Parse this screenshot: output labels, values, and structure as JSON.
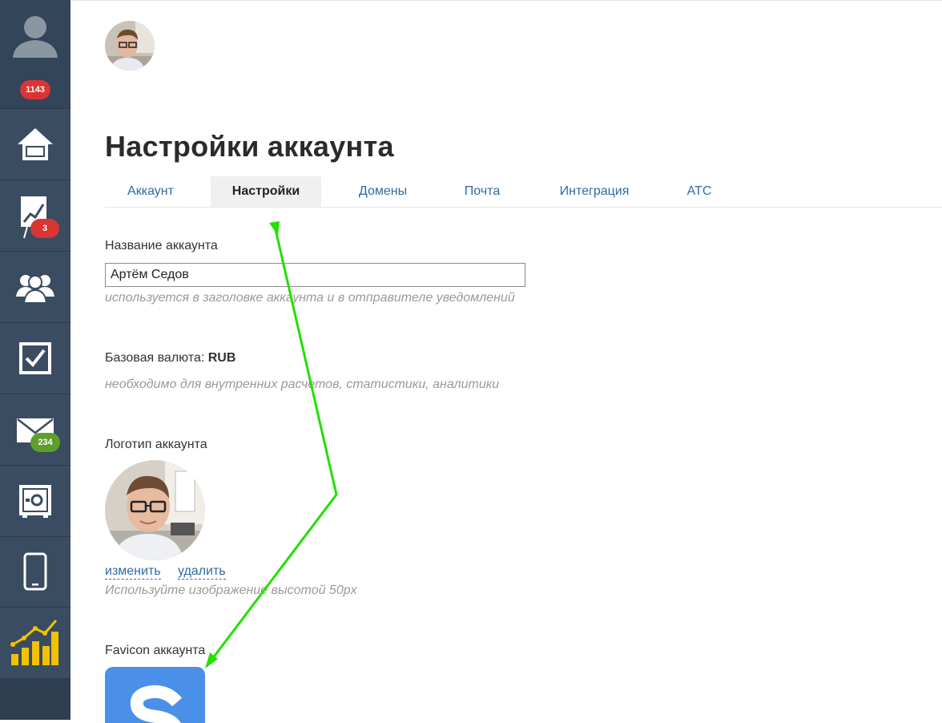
{
  "sidebar": {
    "profile_badge": "1143",
    "deals_badge": "3",
    "mail_badge": "234",
    "badge_red": "#d93535",
    "badge_green": "#5e9f2c",
    "icons": [
      "user-icon",
      "home-icon",
      "chart-board-icon",
      "contacts-icon",
      "tasks-icon",
      "mail-icon",
      "safe-icon",
      "mobile-icon",
      "analytics-icon"
    ]
  },
  "header": {
    "title": "Настройки аккаунта"
  },
  "tabs": [
    {
      "label": "Аккаунт"
    },
    {
      "label": "Настройки",
      "active": true
    },
    {
      "label": "Домены"
    },
    {
      "label": "Почта"
    },
    {
      "label": "Интеграция"
    },
    {
      "label": "АТС"
    }
  ],
  "form": {
    "account_name_label": "Название аккаунта",
    "account_name_value": "Артём Седов",
    "account_name_hint": "используется в заголовке аккаунта и в отправителе уведомлений",
    "currency_label": "Базовая валюта:",
    "currency_value": "RUB",
    "currency_hint": "необходимо для внутренних расчетов, статистики, аналитики",
    "logo_label": "Логотип аккаунта",
    "logo_change": "изменить",
    "logo_delete": "удалить",
    "logo_hint": "Используйте изображение высотой 50px",
    "favicon_label": "Favicon аккаунта"
  },
  "colors": {
    "sidebar_bg": "#2f3f52",
    "link": "#2f6aa3",
    "arrow": "#22e000",
    "favicon_bg": "#4a8fe8"
  }
}
